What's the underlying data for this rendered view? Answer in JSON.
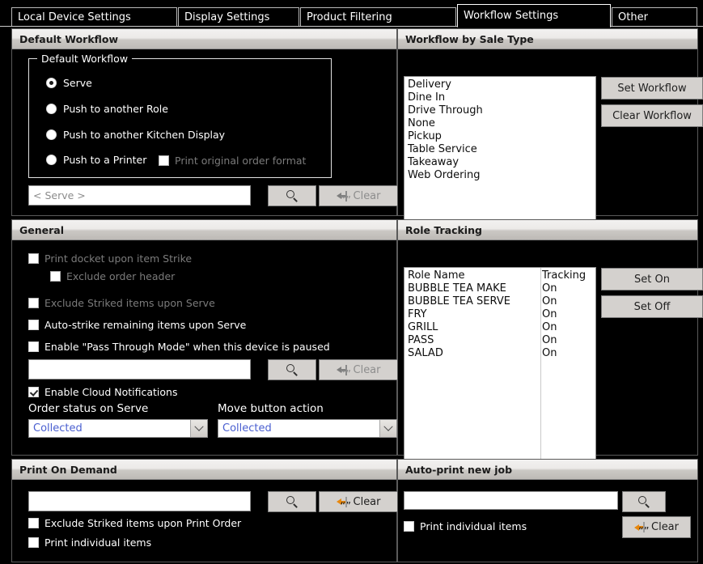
{
  "tabs": [
    {
      "label": "Local Device Settings",
      "active": false
    },
    {
      "label": "Display Settings",
      "active": false
    },
    {
      "label": "Product Filtering",
      "active": false
    },
    {
      "label": "Workflow Settings",
      "active": true
    },
    {
      "label": "Other",
      "active": false
    }
  ],
  "default_workflow": {
    "panel_title": "Default Workflow",
    "groupbox_title": "Default Workflow",
    "options": [
      {
        "label": "Serve",
        "selected": true
      },
      {
        "label": "Push to another Role",
        "selected": false
      },
      {
        "label": "Push to another Kitchen Display",
        "selected": false
      },
      {
        "label": "Push to a Printer",
        "selected": false
      }
    ],
    "print_original_order_format": {
      "label": "Print original order format",
      "checked": false,
      "enabled": false
    },
    "target_input": {
      "value": "",
      "placeholder": "< Serve >"
    },
    "search_button": {
      "label": "",
      "icon": "search-icon",
      "enabled": true
    },
    "clear_button": {
      "label": "Clear",
      "icon": "clear-icon",
      "enabled": false
    }
  },
  "workflow_by_sale_type": {
    "panel_title": "Workflow by Sale Type",
    "items": [
      "Delivery",
      "Dine In",
      "Drive Through",
      "None",
      "Pickup",
      "Table Service",
      "Takeaway",
      "Web Ordering"
    ],
    "set_workflow_label": "Set Workflow",
    "clear_workflow_label": "Clear Workflow"
  },
  "general": {
    "panel_title": "General",
    "checkboxes": [
      {
        "label": "Print docket upon item Strike",
        "checked": false,
        "enabled": false,
        "indent": 0
      },
      {
        "label": "Exclude order header",
        "checked": false,
        "enabled": false,
        "indent": 1
      },
      {
        "label": "Exclude Striked items upon Serve",
        "checked": false,
        "enabled": false,
        "indent": 0
      },
      {
        "label": "Auto-strike remaining items upon Serve",
        "checked": false,
        "enabled": true,
        "indent": 0
      },
      {
        "label": "Enable \"Pass Through Mode\" when this device is paused",
        "checked": false,
        "enabled": true,
        "indent": 0
      }
    ],
    "pass_through_input": {
      "value": "",
      "placeholder": ""
    },
    "search_button": {
      "label": "",
      "icon": "search-icon",
      "enabled": true
    },
    "clear_button": {
      "label": "Clear",
      "icon": "clear-icon",
      "enabled": false
    },
    "cloud_notifications": {
      "label": "Enable Cloud Notifications",
      "checked": true,
      "enabled": true
    },
    "order_status_on_serve": {
      "label": "Order status on Serve",
      "value": "Collected"
    },
    "move_button_action": {
      "label": "Move button action",
      "value": "Collected"
    }
  },
  "role_tracking": {
    "panel_title": "Role Tracking",
    "columns": [
      "Role Name",
      "Tracking"
    ],
    "rows": [
      {
        "role": "BUBBLE TEA MAKE",
        "tracking": "On"
      },
      {
        "role": "BUBBLE TEA SERVE",
        "tracking": "On"
      },
      {
        "role": "FRY",
        "tracking": "On"
      },
      {
        "role": "GRILL",
        "tracking": "On"
      },
      {
        "role": "PASS",
        "tracking": "On"
      },
      {
        "role": "SALAD",
        "tracking": "On"
      }
    ],
    "set_on_label": "Set On",
    "set_off_label": "Set Off"
  },
  "print_on_demand": {
    "panel_title": "Print On Demand",
    "printer_input": {
      "value": "",
      "placeholder": ""
    },
    "search_button": {
      "label": "",
      "icon": "search-icon",
      "enabled": true
    },
    "clear_button": {
      "label": "Clear",
      "icon": "clear-icon",
      "enabled": true
    },
    "checkboxes": [
      {
        "label": "Exclude Striked items upon Print Order",
        "checked": false,
        "enabled": true
      },
      {
        "label": "Print individual items",
        "checked": false,
        "enabled": true
      }
    ]
  },
  "auto_print_new_job": {
    "panel_title": "Auto-print new job",
    "printer_input": {
      "value": "",
      "placeholder": ""
    },
    "search_button": {
      "label": "",
      "icon": "search-icon",
      "enabled": true
    },
    "clear_button": {
      "label": "Clear",
      "icon": "clear-icon",
      "enabled": true
    },
    "checkboxes": [
      {
        "label": "Print individual items",
        "checked": false,
        "enabled": true
      }
    ]
  },
  "colors": {
    "background": "#000000",
    "panel_header_light": "#f2f1f0",
    "panel_header_dark": "#bdbab6",
    "accent_orange": "#e8880e",
    "select_text_blue": "#4a5fd0",
    "disabled_text": "#7b7b7b"
  }
}
